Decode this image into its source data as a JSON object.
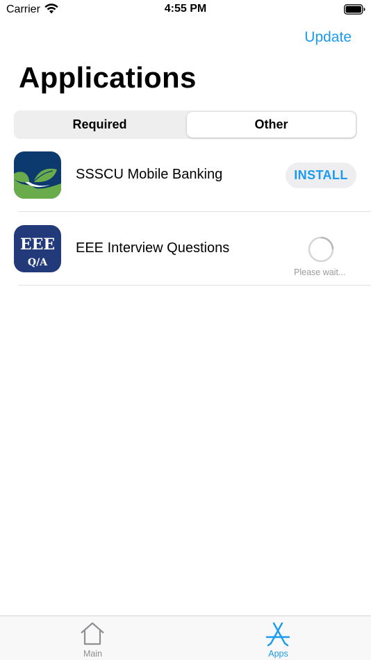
{
  "status_bar": {
    "carrier": "Carrier",
    "time": "4:55 PM",
    "icons": [
      "wifi-icon",
      "battery-icon"
    ]
  },
  "nav": {
    "title": "Applications",
    "update_label": "Update"
  },
  "segmented_control": {
    "segments": [
      {
        "label": "Required",
        "selected": false
      },
      {
        "label": "Other",
        "selected": true
      }
    ]
  },
  "apps": [
    {
      "name": "SSSCU Mobile Banking",
      "icon": "sssc-logo-icon",
      "action_label": "INSTALL",
      "state": "install"
    },
    {
      "name": "EEE Interview Questions",
      "icon": "eee-qa-icon",
      "icon_text_top": "EEE",
      "icon_text_bottom": "Q/A",
      "status_label": "Please wait...",
      "state": "loading"
    }
  ],
  "tab_bar": {
    "items": [
      {
        "label": "Main",
        "icon": "house-icon",
        "active": false
      },
      {
        "label": "Apps",
        "icon": "app-store-icon",
        "active": true
      }
    ]
  },
  "colors": {
    "accent": "#1a9bf0",
    "inactive_tab": "#8e8e93",
    "segment_bg": "#eeeef0",
    "eee_icon_bg": "#233a7a",
    "sssc_green": "#6aab4c",
    "sssc_navy": "#0d3a6e"
  }
}
